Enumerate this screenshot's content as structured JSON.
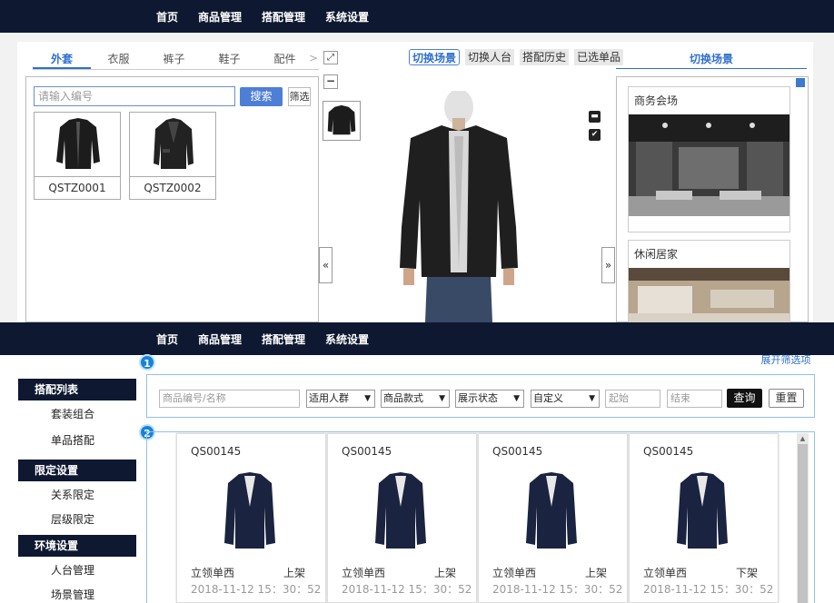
{
  "top_panel": {
    "nav": [
      "首页",
      "商品管理",
      "搭配管理",
      "系统设置"
    ],
    "category_tabs": [
      "外套",
      "衣服",
      "裤子",
      "鞋子",
      "配件"
    ],
    "active_tab": "外套",
    "more_arrow": ">",
    "search_placeholder": "请输入编号",
    "search_button": "搜索",
    "filter_button": "筛选",
    "products": [
      {
        "code": "QSTZ0001"
      },
      {
        "code": "QSTZ0002"
      }
    ],
    "toolbar_tabs": [
      "切换场景",
      "切换人台",
      "搭配历史",
      "已选单品"
    ],
    "scene_header": "切换场景",
    "scenes": [
      {
        "name": "商务会场"
      },
      {
        "name": "休闲居家"
      }
    ],
    "nav_left": "«",
    "nav_right": "»"
  },
  "bottom_panel": {
    "nav": [
      "首页",
      "商品管理",
      "搭配管理",
      "系统设置"
    ],
    "sidebar": [
      {
        "header": "搭配列表",
        "items": [
          "套装组合",
          "单品搭配"
        ]
      },
      {
        "header": "限定设置",
        "items": [
          "关系限定",
          "层级限定"
        ]
      },
      {
        "header": "环境设置",
        "items": [
          "人台管理",
          "场景管理"
        ]
      }
    ],
    "badges": [
      "1",
      "2"
    ],
    "expand_link": "展开筛选项",
    "filters": {
      "code_placeholder": "商品编号/名称",
      "selects": [
        "适用人群",
        "商品款式",
        "展示状态",
        "自定义"
      ],
      "start_placeholder": "起始",
      "end_placeholder": "结束",
      "query_button": "查询",
      "reset_button": "重置"
    },
    "cards": [
      {
        "code": "QS00145",
        "name": "立领单西",
        "status": "上架",
        "date": "2018-11-12 15：30：52"
      },
      {
        "code": "QS00145",
        "name": "立领单西",
        "status": "上架",
        "date": "2018-11-12 15：30：52"
      },
      {
        "code": "QS00145",
        "name": "立领单西",
        "status": "上架",
        "date": "2018-11-12 15：30：52"
      },
      {
        "code": "QS00145",
        "name": "立领单西",
        "status": "下架",
        "date": "2018-11-12 15：30：52"
      }
    ]
  },
  "colors": {
    "navbar": "#0e1830",
    "accent": "#2e6fd0",
    "frame": "#8ec3ea"
  }
}
